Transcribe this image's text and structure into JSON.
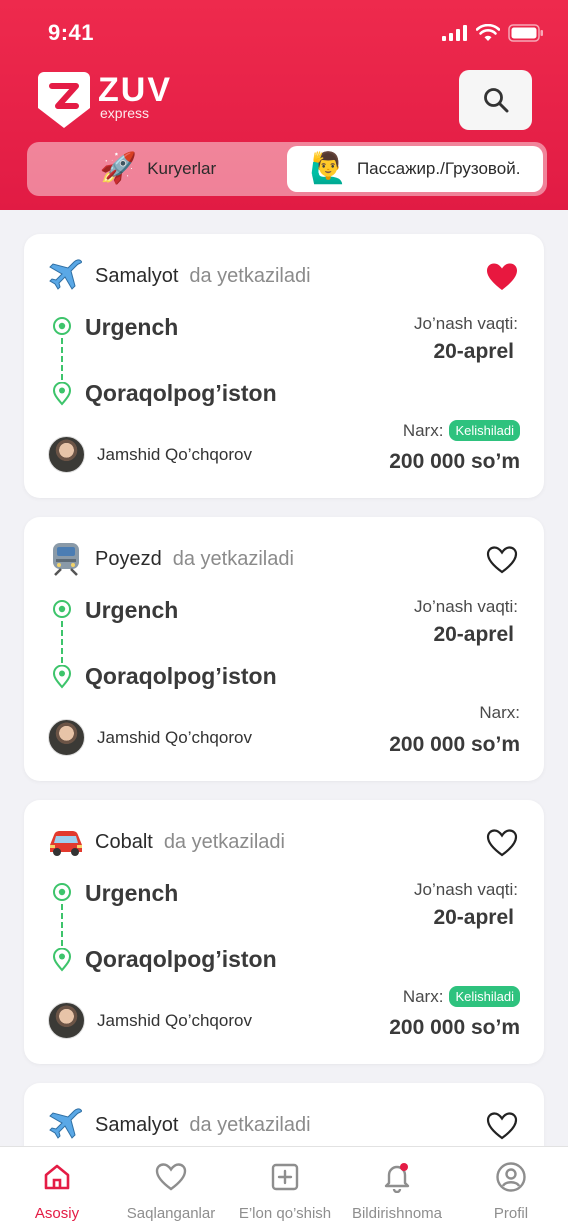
{
  "status_bar": {
    "time": "9:41"
  },
  "brand": {
    "name": "ZUV",
    "tagline": "express"
  },
  "header": {
    "search_icon": "search-icon",
    "toggle": {
      "couriers_label": "Kuryerlar",
      "passenger_label": "Пассажир./Грузовой.",
      "active": "passenger"
    }
  },
  "listings": [
    {
      "transport": "Samalyot",
      "transport_icon": "airplane-icon",
      "suffix": "da yetkaziladi",
      "favorite": true,
      "from": "Urgench",
      "to": "Qoraqolpog’iston",
      "date_label": "Jo’nash vaqti:",
      "date": "20-aprel",
      "user": "Jamshid Qo’chqorov",
      "price_label": "Narx:",
      "price_badge": "Kelishiladi",
      "price": "200 000 so’m"
    },
    {
      "transport": "Poyezd",
      "transport_icon": "train-icon",
      "suffix": "da yetkaziladi",
      "favorite": false,
      "from": "Urgench",
      "to": "Qoraqolpog’iston",
      "date_label": "Jo’nash vaqti:",
      "date": "20-aprel",
      "user": "Jamshid Qo’chqorov",
      "price_label": "Narx:",
      "price_badge": "",
      "price": "200 000 so’m"
    },
    {
      "transport": "Cobalt",
      "transport_icon": "car-icon",
      "suffix": "da yetkaziladi",
      "favorite": false,
      "from": "Urgench",
      "to": "Qoraqolpog’iston",
      "date_label": "Jo’nash vaqti:",
      "date": "20-aprel",
      "user": "Jamshid Qo’chqorov",
      "price_label": "Narx:",
      "price_badge": "Kelishiladi",
      "price": "200 000 so’m"
    },
    {
      "transport": "Samalyot",
      "transport_icon": "airplane-icon",
      "suffix": "da yetkaziladi",
      "favorite": false
    }
  ],
  "bottom_nav": [
    {
      "label": "Asosiy",
      "icon": "home-icon",
      "active": true
    },
    {
      "label": "Saqlanganlar",
      "icon": "heart-icon",
      "active": false
    },
    {
      "label": "E’lon qo’shish",
      "icon": "plus-square-icon",
      "active": false
    },
    {
      "label": "Bildirishnoma",
      "icon": "bell-icon",
      "active": false
    },
    {
      "label": "Profil",
      "icon": "user-circle-icon",
      "active": false
    }
  ],
  "colors": {
    "brand": "#e41c45",
    "accent_green": "#2ec27e",
    "route_green": "#3dc46b"
  }
}
